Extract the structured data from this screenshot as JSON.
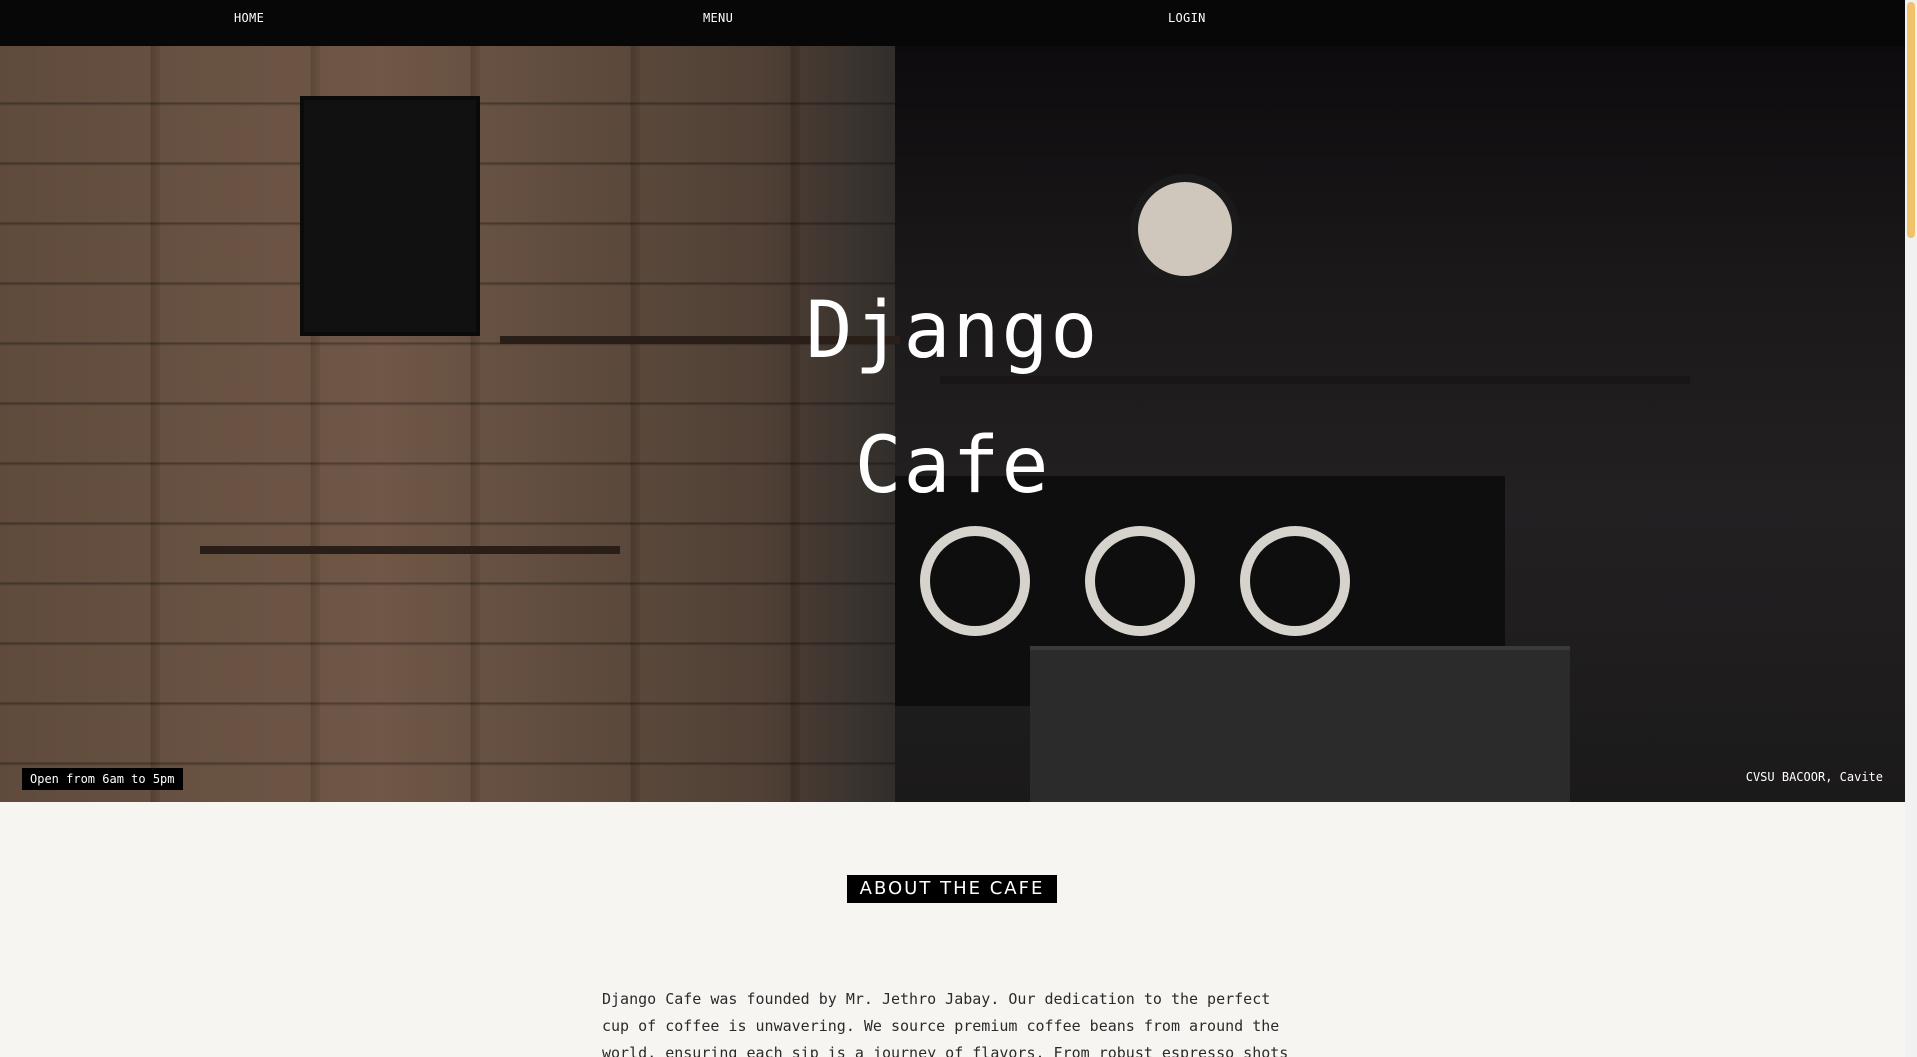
{
  "nav": {
    "home": "HOME",
    "menu": "MENU",
    "login": "LOGIN"
  },
  "hero": {
    "title_line1": "Django",
    "title_line2": "Cafe",
    "hours": "Open from 6am to 5pm",
    "location": "CVSU BACOOR, Cavite"
  },
  "about": {
    "heading": "ABOUT THE CAFE",
    "text": "Django Cafe was founded by Mr. Jethro Jabay. Our dedication to the perfect cup of coffee is unwavering. We source premium coffee beans from around the world, ensuring each sip is a journey of flavors. From robust espresso shots"
  },
  "colors": {
    "nav_bg": "#070707",
    "page_bg": "#f6f5f1",
    "scroll_thumb": "#f0c36b"
  }
}
